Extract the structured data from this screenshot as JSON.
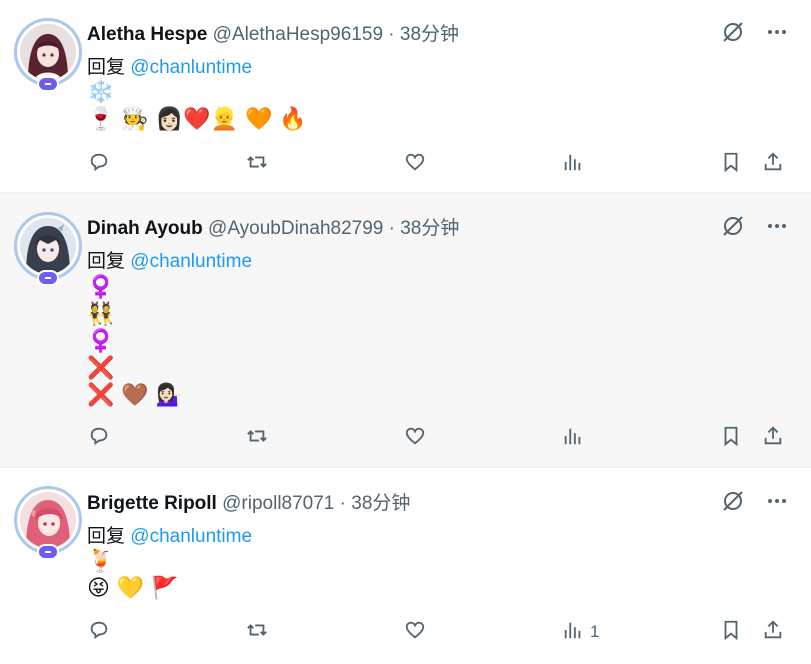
{
  "tweets": [
    {
      "name": "Aletha Hespe",
      "handle": "@AlethaHesp96159",
      "dot": "·",
      "time": "38分钟",
      "reply_prefix": "回复",
      "mention": "@chanluntime",
      "lines": [
        "❄️",
        "🍷 🧑‍🍳 👩🏻❤️👱 🧡 🔥"
      ],
      "views_count": ""
    },
    {
      "name": "Dinah Ayoub",
      "handle": "@AyoubDinah82799",
      "dot": "·",
      "time": "38分钟",
      "reply_prefix": "回复",
      "mention": "@chanluntime",
      "lines": [
        "♀️",
        "👯",
        "♀️",
        "❌",
        "❌ 🤎 💁🏻‍♀️"
      ],
      "views_count": ""
    },
    {
      "name": "Brigette Ripoll",
      "handle": "@ripoll87071",
      "dot": "·",
      "time": "38分钟",
      "reply_prefix": "回复",
      "mention": "@chanluntime",
      "lines": [
        "🍹",
        "😝 💛 🚩"
      ],
      "views_count": "1"
    }
  ],
  "icons": {
    "grok": "grok-slash-circle-icon",
    "more": "more-dots-icon",
    "reply": "reply-bubble-icon",
    "retweet": "retweet-arrows-icon",
    "like": "heart-icon",
    "views": "views-bars-icon",
    "bookmark": "bookmark-icon",
    "share": "share-upload-icon"
  },
  "colors": {
    "mention": "#1d9bf0",
    "meta": "#536471",
    "text": "#0f1419",
    "highlight_bg": "#f7f7f7",
    "avatar_ring": "#a9c8f0",
    "badge": "#6f5cf0"
  }
}
